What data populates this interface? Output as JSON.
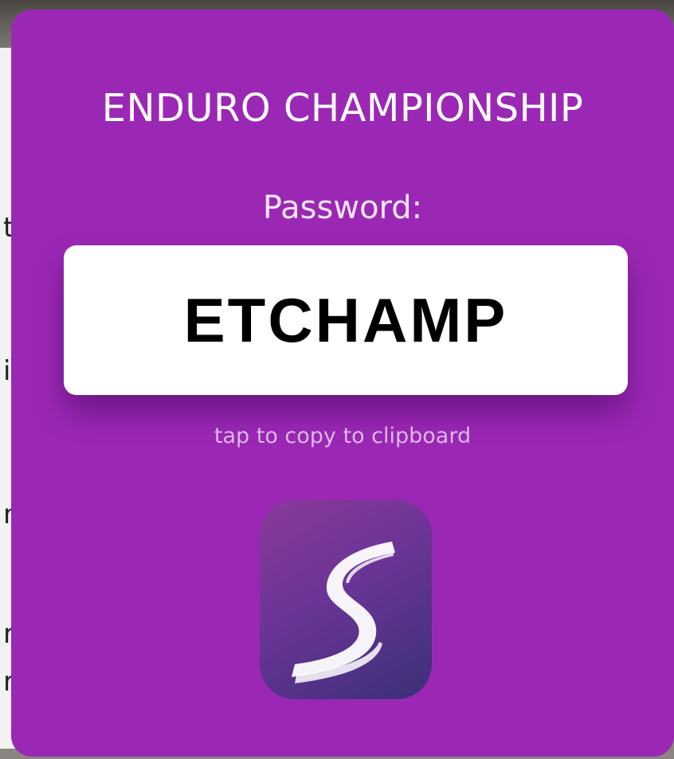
{
  "dialog": {
    "title": "ENDURO CHAMPIONSHIP",
    "password_label": "Password:",
    "password_value": "ETCHAMP",
    "copy_hint": "tap to copy to clipboard"
  },
  "backdrop": {
    "glyphs": [
      "t",
      "i",
      "n",
      "r",
      "r"
    ]
  },
  "app_icon": {
    "icon_name": "s-swoosh-app-icon"
  },
  "colors": {
    "card_background": "#9b28b5",
    "password_box": "#ffffff",
    "icon_gradient_start": "#8a3a9a",
    "icon_gradient_end": "#3b3078"
  }
}
